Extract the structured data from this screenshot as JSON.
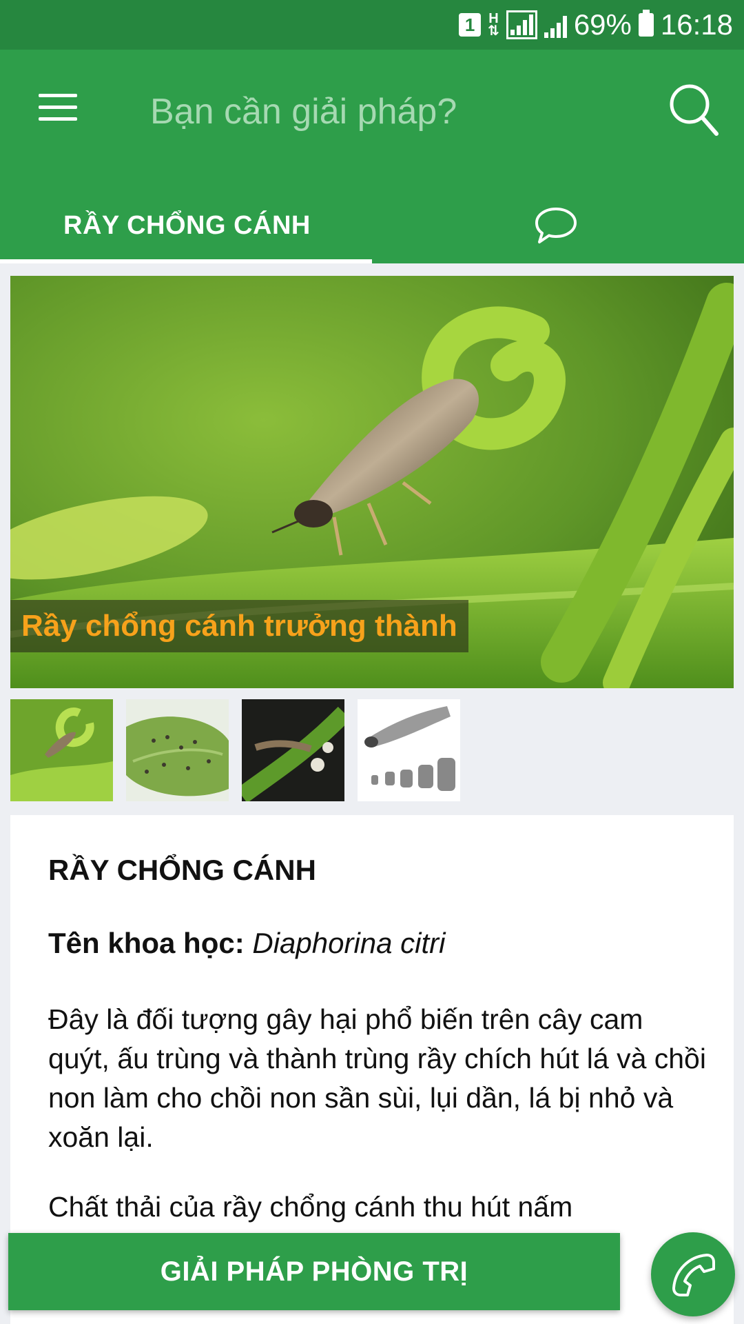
{
  "status_bar": {
    "sim_slot": "1",
    "network_type": "H",
    "battery": "69%",
    "time": "16:18"
  },
  "app_bar": {
    "menu_icon": "hamburger-menu-icon",
    "search_placeholder": "Bạn cần giải pháp?",
    "search_icon": "search-icon"
  },
  "tabs": {
    "active_label": "RẦY CHỔNG CÁNH",
    "chat_icon": "chat-bubble-icon"
  },
  "gallery": {
    "caption": "Rầy chổng cánh trưởng thành",
    "thumbnail_count": 4
  },
  "article": {
    "title": "RẦY CHỔNG CÁNH",
    "scientific_label": "Tên khoa học:",
    "scientific_name": "Diaphorina citri",
    "paragraphs": [
      "Đây là đối tượng gây hại phổ biến trên cây cam quýt, ấu trùng và thành trùng rầy chích hút lá và chồi non làm cho chồi non sần sùi, lụi dần, lá bị nhỏ và xoăn lại.",
      "Chất thải của rầy chổng cánh thu hút nấm"
    ]
  },
  "actions": {
    "solution_button": "GIẢI PHÁP PHÒNG TRỊ",
    "call_icon": "phone-icon"
  },
  "colors": {
    "primary": "#2e9e4a",
    "status_bar": "#26873f",
    "caption_text": "#f7a21b"
  }
}
